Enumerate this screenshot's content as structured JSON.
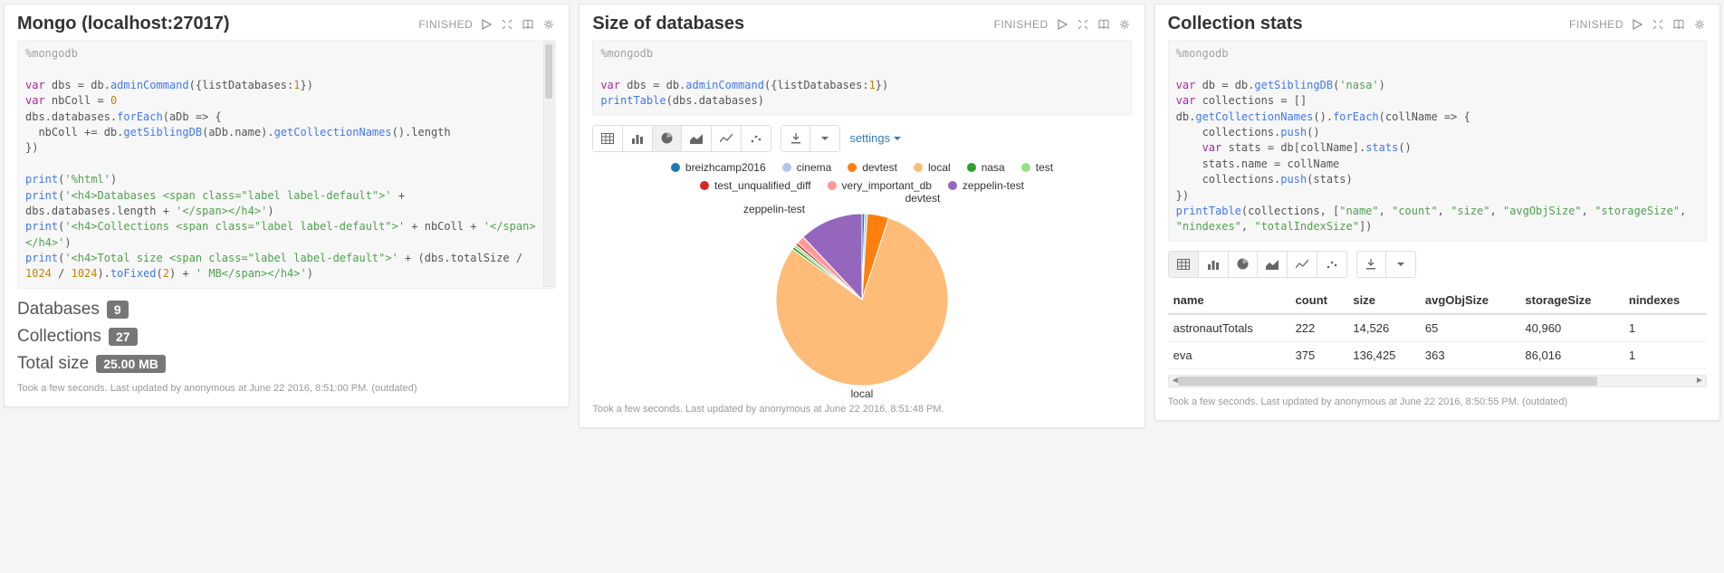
{
  "status_label": "FINISHED",
  "settings_label": "settings",
  "panels": {
    "mongo": {
      "title": "Mongo (localhost:27017)",
      "code": "%mongodb\n\nvar dbs = db.adminCommand({listDatabases:1})\nvar nbColl = 0\ndbs.databases.forEach(aDb => {\n  nbColl += db.getSiblingDB(aDb.name).getCollectionNames().length\n})\n\nprint('%html')\nprint('<h4>Databases <span class=\"label label-default\">' + dbs.databases.length + '</span></h4>')\nprint('<h4>Collections <span class=\"label label-default\">' + nbColl + '</span></h4>')\nprint('<h4>Total size <span class=\"label label-default\">' + (dbs.totalSize / 1024 / 1024).toFixed(2) + ' MB</span></h4>')",
      "results": {
        "databases_label": "Databases",
        "databases_count": "9",
        "collections_label": "Collections",
        "collections_count": "27",
        "totalsize_label": "Total size",
        "totalsize_value": "25.00 MB"
      },
      "footnote": "Took a few seconds. Last updated by anonymous at June 22 2016, 8:51:00 PM. (outdated)"
    },
    "size": {
      "title": "Size of databases",
      "code": "%mongodb\n\nvar dbs = db.adminCommand({listDatabases:1})\nprintTable(dbs.databases)",
      "labels": {
        "devtest": "devtest",
        "zeppelin": "zeppelin-test",
        "local": "local"
      },
      "footnote": "Took a few seconds. Last updated by anonymous at June 22 2016, 8:51:48 PM."
    },
    "stats": {
      "title": "Collection stats",
      "code": "%mongodb\n\nvar db = db.getSiblingDB('nasa')\nvar collections = []\ndb.getCollectionNames().forEach(collName => {\n    collections.push()\n    var stats = db[collName].stats()\n    stats.name = collName\n    collections.push(stats)\n})\nprintTable(collections, [\"name\", \"count\", \"size\", \"avgObjSize\", \"storageSize\", \"nindexes\", \"totalIndexSize\"])",
      "footnote": "Took a few seconds. Last updated by anonymous at June 22 2016, 8:50:55 PM. (outdated)"
    }
  },
  "chart_data": {
    "type": "pie",
    "title": "Size of databases",
    "series": [
      {
        "name": "breizhcamp2016",
        "value": 0.5,
        "color": "#1f77b4"
      },
      {
        "name": "cinema",
        "value": 0.5,
        "color": "#aec7e8"
      },
      {
        "name": "devtest",
        "value": 4,
        "color": "#ff7f0e"
      },
      {
        "name": "local",
        "value": 80,
        "color": "#ffbb78"
      },
      {
        "name": "nasa",
        "value": 0.5,
        "color": "#2ca02c"
      },
      {
        "name": "test",
        "value": 0.5,
        "color": "#98df8a"
      },
      {
        "name": "test_unqualified_diff",
        "value": 0.5,
        "color": "#d62728"
      },
      {
        "name": "very_important_db",
        "value": 1.5,
        "color": "#ff9896"
      },
      {
        "name": "zeppelin-test",
        "value": 12,
        "color": "#9467bd"
      }
    ]
  },
  "stats_table": {
    "columns": [
      "name",
      "count",
      "size",
      "avgObjSize",
      "storageSize",
      "nindexes"
    ],
    "rows": [
      {
        "name": "astronautTotals",
        "count": "222",
        "size": "14,526",
        "avgObjSize": "65",
        "storageSize": "40,960",
        "nindexes": "1"
      },
      {
        "name": "eva",
        "count": "375",
        "size": "136,425",
        "avgObjSize": "363",
        "storageSize": "86,016",
        "nindexes": "1"
      }
    ]
  }
}
